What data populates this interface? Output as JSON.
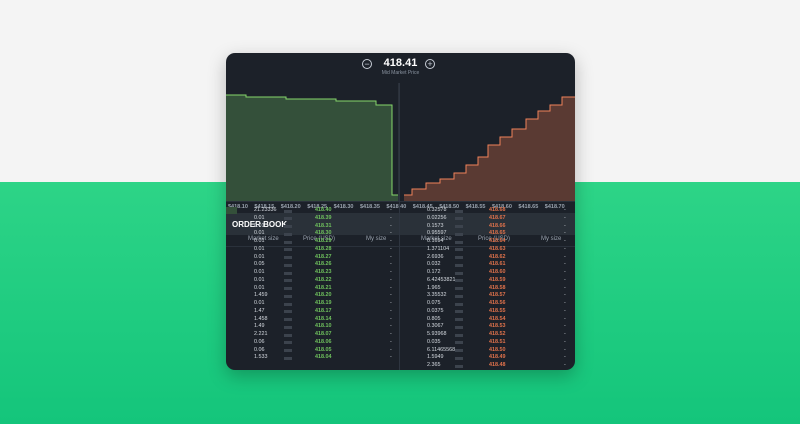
{
  "header": {
    "mid_price": "418.41",
    "mid_label": "Mid Market Price",
    "zoom_out": "−",
    "zoom_in": "+"
  },
  "axis_ticks": [
    "$418.10",
    "$418.15",
    "$418.20",
    "$418.25",
    "$418.30",
    "$418.35",
    "$418.40",
    "$418.45",
    "$418.50",
    "$418.55",
    "$418.60",
    "$418.65",
    "$418.70"
  ],
  "order_book": {
    "title": "ORDER BOOK",
    "bid_columns": [
      "Market size",
      "Price (USD)",
      "My size"
    ],
    "ask_columns": [
      "Market size",
      "Price (USD)",
      "My size"
    ],
    "bids": [
      {
        "size": "21.23336",
        "price": "418.40",
        "mine": "-"
      },
      {
        "size": "0.01",
        "price": "418.39",
        "mine": "-"
      },
      {
        "size": "0.01",
        "price": "418.31",
        "mine": "-"
      },
      {
        "size": "0.01",
        "price": "418.30",
        "mine": "-"
      },
      {
        "size": "0.01",
        "price": "418.29",
        "mine": "-"
      },
      {
        "size": "0.01",
        "price": "418.28",
        "mine": "-"
      },
      {
        "size": "0.01",
        "price": "418.27",
        "mine": "-"
      },
      {
        "size": "0.05",
        "price": "418.26",
        "mine": "-"
      },
      {
        "size": "0.01",
        "price": "418.23",
        "mine": "-"
      },
      {
        "size": "0.01",
        "price": "418.22",
        "mine": "-"
      },
      {
        "size": "0.01",
        "price": "418.21",
        "mine": "-"
      },
      {
        "size": "1.459",
        "price": "418.20",
        "mine": "-"
      },
      {
        "size": "0.01",
        "price": "418.19",
        "mine": "-"
      },
      {
        "size": "1.47",
        "price": "418.17",
        "mine": "-"
      },
      {
        "size": "1.458",
        "price": "418.14",
        "mine": "-"
      },
      {
        "size": "1.49",
        "price": "418.10",
        "mine": "-"
      },
      {
        "size": "2.221",
        "price": "418.07",
        "mine": "-"
      },
      {
        "size": "0.06",
        "price": "418.06",
        "mine": "-"
      },
      {
        "size": "0.06",
        "price": "418.05",
        "mine": "-"
      },
      {
        "size": "1.533",
        "price": "418.04",
        "mine": "-"
      }
    ],
    "asks": [
      {
        "size": "0.32578",
        "price": "418.68",
        "mine": "-"
      },
      {
        "size": "0.02256",
        "price": "418.67",
        "mine": "-"
      },
      {
        "size": "0.1573",
        "price": "418.66",
        "mine": "-"
      },
      {
        "size": "0.95597",
        "price": "418.65",
        "mine": "-"
      },
      {
        "size": "0.1694",
        "price": "418.64",
        "mine": "-"
      },
      {
        "size": "1.371104",
        "price": "418.63",
        "mine": "-"
      },
      {
        "size": "2.6936",
        "price": "418.62",
        "mine": "-"
      },
      {
        "size": "0.032",
        "price": "418.61",
        "mine": "-"
      },
      {
        "size": "0.172",
        "price": "418.60",
        "mine": "-"
      },
      {
        "size": "6.42453821",
        "price": "418.59",
        "mine": "-"
      },
      {
        "size": "1.965",
        "price": "418.58",
        "mine": "-"
      },
      {
        "size": "3.35532",
        "price": "418.57",
        "mine": "-"
      },
      {
        "size": "0.075",
        "price": "418.56",
        "mine": "-"
      },
      {
        "size": "0.0375",
        "price": "418.55",
        "mine": "-"
      },
      {
        "size": "0.805",
        "price": "418.54",
        "mine": "-"
      },
      {
        "size": "0.3067",
        "price": "418.53",
        "mine": "-"
      },
      {
        "size": "5.93968",
        "price": "418.52",
        "mine": "-"
      },
      {
        "size": "0.035",
        "price": "418.51",
        "mine": "-"
      },
      {
        "size": "6.11465568",
        "price": "418.50",
        "mine": "-"
      },
      {
        "size": "1.5949",
        "price": "418.49",
        "mine": "-"
      },
      {
        "size": "2.365",
        "price": "418.48",
        "mine": "-"
      }
    ]
  },
  "colors": {
    "bid": "#6fc15d",
    "ask": "#e0724b",
    "bid_fill": "#34503a",
    "ask_fill": "#5a3a33"
  }
}
